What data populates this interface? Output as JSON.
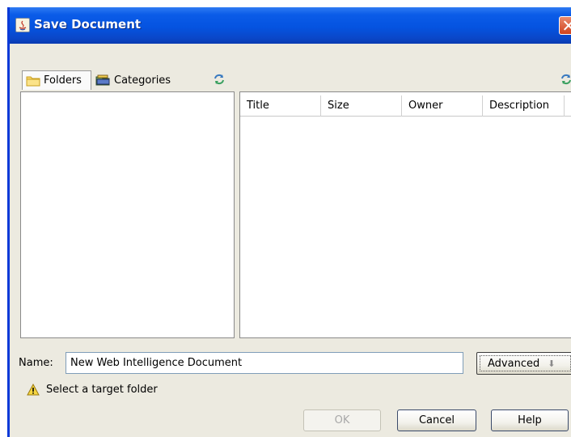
{
  "window": {
    "title": "Save Document"
  },
  "tabs": [
    {
      "label": "Folders",
      "icon": "folder-icon",
      "selected": true
    },
    {
      "label": "Categories",
      "icon": "categories-icon",
      "selected": false
    }
  ],
  "table": {
    "columns": [
      "Title",
      "Size",
      "Owner",
      "Description"
    ],
    "rows": []
  },
  "name_field": {
    "label": "Name:",
    "value": "New Web Intelligence Document"
  },
  "advanced_button": {
    "label": "Advanced",
    "icon": "arrow-down-icon"
  },
  "status": {
    "icon": "warning-icon",
    "message": "Select a target folder"
  },
  "buttons": {
    "ok": "OK",
    "cancel": "Cancel",
    "help": "Help"
  },
  "colors": {
    "titlebar": "#0553e0",
    "dialog_bg": "#eceae0",
    "close_button": "#d1421c"
  }
}
